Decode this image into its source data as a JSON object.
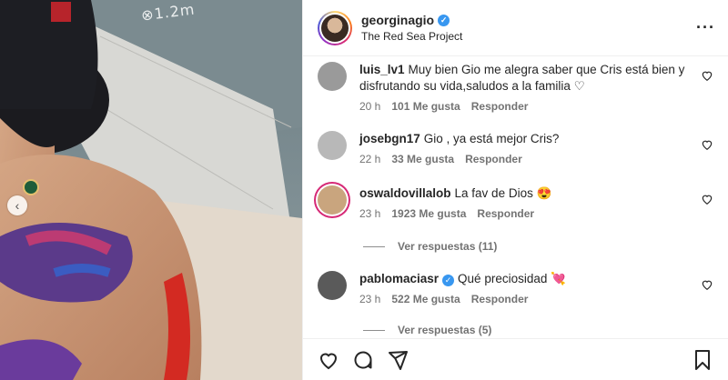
{
  "photo": {
    "overlay_text": "⊗1.2m",
    "prev_icon": "chevron-left-icon"
  },
  "post": {
    "username": "georginagio",
    "location": "The Red Sea Project",
    "more_icon": "more-horizontal-icon"
  },
  "comments": [
    {
      "user": "luis_lv1",
      "text": "Muy bien Gio me alegra saber que Cris está bien y disfrutando su vida,saludos a la familia ♡",
      "time": "20 h",
      "likes": "101 Me gusta",
      "reply": "Responder",
      "avatar_color": "#9a9a9a"
    },
    {
      "user": "josebgn17",
      "text": "Gio , ya está mejor Cris?",
      "time": "22 h",
      "likes": "33 Me gusta",
      "reply": "Responder",
      "avatar_color": "#b8b8b8"
    },
    {
      "user": "oswaldovillalob",
      "text": "La fav de Dios 😍",
      "time": "23 h",
      "likes": "1923 Me gusta",
      "reply": "Responder",
      "view_replies": "Ver respuestas (11)",
      "avatar_color": "#c9a57e"
    },
    {
      "user": "pablomaciasr",
      "text": "Qué preciosidad 💘",
      "time": "23 h",
      "likes": "522 Me gusta",
      "reply": "Responder",
      "view_replies": "Ver respuestas (5)",
      "avatar_color": "#5a5a5a"
    }
  ],
  "colors": {
    "verified": "#3897f0",
    "meta_text": "#737373",
    "primary_text": "#262626"
  }
}
